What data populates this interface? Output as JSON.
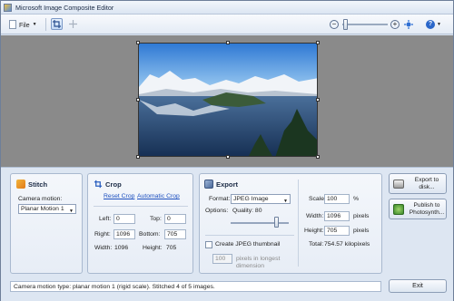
{
  "window": {
    "title": "Microsoft Image Composite Editor"
  },
  "toolbar": {
    "file_label": "File",
    "zoom_out_icon": "minus-circle-icon",
    "zoom_in_icon": "plus-circle-icon",
    "zoom_level": 0.05,
    "help_icon": "question-icon"
  },
  "stitch": {
    "title": "Stitch",
    "camera_motion_label": "Camera motion:",
    "camera_motion_value": "Planar Motion 1"
  },
  "crop": {
    "title": "Crop",
    "reset_label": "Reset Crop",
    "automatic_label": "Automatic Crop",
    "left_label": "Left:",
    "left_value": "0",
    "top_label": "Top:",
    "top_value": "0",
    "right_label": "Right:",
    "right_value": "1096",
    "bottom_label": "Bottom:",
    "bottom_value": "705",
    "width_label": "Width:",
    "width_value": "1096",
    "height_label": "Height:",
    "height_value": "705"
  },
  "export": {
    "title": "Export",
    "format_label": "Format:",
    "format_value": "JPEG Image",
    "options_label": "Options:",
    "quality_label": "Quality: 80",
    "quality_value": 80,
    "thumbnail_label": "Create JPEG thumbnail",
    "thumbnail_checked": false,
    "thumb_size_value": "100",
    "thumb_size_label": "pixels in longest dimension",
    "scale_label": "Scale:",
    "scale_value": "100",
    "scale_unit": "%",
    "width_label": "Width:",
    "width_value": "1096",
    "width_unit": "pixels",
    "height_label": "Height:",
    "height_value": "705",
    "height_unit": "pixels",
    "total_label": "Total:",
    "total_value": "754.57 kilopixels"
  },
  "actions": {
    "export_disk_label": "Export to disk...",
    "publish_label": "Publish to Photosynth...",
    "exit_label": "Exit"
  },
  "status": {
    "text": "Camera motion type: planar motion 1 (rigid scale). Stitched 4 of 5 images."
  }
}
